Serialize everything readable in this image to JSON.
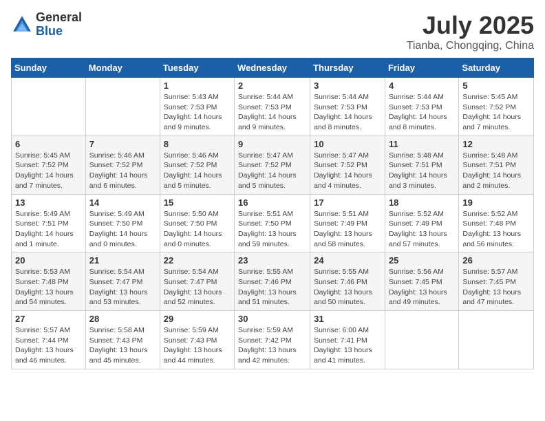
{
  "logo": {
    "general": "General",
    "blue": "Blue"
  },
  "title": {
    "month": "July 2025",
    "location": "Tianba, Chongqing, China"
  },
  "headers": [
    "Sunday",
    "Monday",
    "Tuesday",
    "Wednesday",
    "Thursday",
    "Friday",
    "Saturday"
  ],
  "weeks": [
    [
      {
        "day": "",
        "info": ""
      },
      {
        "day": "",
        "info": ""
      },
      {
        "day": "1",
        "info": "Sunrise: 5:43 AM\nSunset: 7:53 PM\nDaylight: 14 hours and 9 minutes."
      },
      {
        "day": "2",
        "info": "Sunrise: 5:44 AM\nSunset: 7:53 PM\nDaylight: 14 hours and 9 minutes."
      },
      {
        "day": "3",
        "info": "Sunrise: 5:44 AM\nSunset: 7:53 PM\nDaylight: 14 hours and 8 minutes."
      },
      {
        "day": "4",
        "info": "Sunrise: 5:44 AM\nSunset: 7:53 PM\nDaylight: 14 hours and 8 minutes."
      },
      {
        "day": "5",
        "info": "Sunrise: 5:45 AM\nSunset: 7:52 PM\nDaylight: 14 hours and 7 minutes."
      }
    ],
    [
      {
        "day": "6",
        "info": "Sunrise: 5:45 AM\nSunset: 7:52 PM\nDaylight: 14 hours and 7 minutes."
      },
      {
        "day": "7",
        "info": "Sunrise: 5:46 AM\nSunset: 7:52 PM\nDaylight: 14 hours and 6 minutes."
      },
      {
        "day": "8",
        "info": "Sunrise: 5:46 AM\nSunset: 7:52 PM\nDaylight: 14 hours and 5 minutes."
      },
      {
        "day": "9",
        "info": "Sunrise: 5:47 AM\nSunset: 7:52 PM\nDaylight: 14 hours and 5 minutes."
      },
      {
        "day": "10",
        "info": "Sunrise: 5:47 AM\nSunset: 7:52 PM\nDaylight: 14 hours and 4 minutes."
      },
      {
        "day": "11",
        "info": "Sunrise: 5:48 AM\nSunset: 7:51 PM\nDaylight: 14 hours and 3 minutes."
      },
      {
        "day": "12",
        "info": "Sunrise: 5:48 AM\nSunset: 7:51 PM\nDaylight: 14 hours and 2 minutes."
      }
    ],
    [
      {
        "day": "13",
        "info": "Sunrise: 5:49 AM\nSunset: 7:51 PM\nDaylight: 14 hours and 1 minute."
      },
      {
        "day": "14",
        "info": "Sunrise: 5:49 AM\nSunset: 7:50 PM\nDaylight: 14 hours and 0 minutes."
      },
      {
        "day": "15",
        "info": "Sunrise: 5:50 AM\nSunset: 7:50 PM\nDaylight: 14 hours and 0 minutes."
      },
      {
        "day": "16",
        "info": "Sunrise: 5:51 AM\nSunset: 7:50 PM\nDaylight: 13 hours and 59 minutes."
      },
      {
        "day": "17",
        "info": "Sunrise: 5:51 AM\nSunset: 7:49 PM\nDaylight: 13 hours and 58 minutes."
      },
      {
        "day": "18",
        "info": "Sunrise: 5:52 AM\nSunset: 7:49 PM\nDaylight: 13 hours and 57 minutes."
      },
      {
        "day": "19",
        "info": "Sunrise: 5:52 AM\nSunset: 7:48 PM\nDaylight: 13 hours and 56 minutes."
      }
    ],
    [
      {
        "day": "20",
        "info": "Sunrise: 5:53 AM\nSunset: 7:48 PM\nDaylight: 13 hours and 54 minutes."
      },
      {
        "day": "21",
        "info": "Sunrise: 5:54 AM\nSunset: 7:47 PM\nDaylight: 13 hours and 53 minutes."
      },
      {
        "day": "22",
        "info": "Sunrise: 5:54 AM\nSunset: 7:47 PM\nDaylight: 13 hours and 52 minutes."
      },
      {
        "day": "23",
        "info": "Sunrise: 5:55 AM\nSunset: 7:46 PM\nDaylight: 13 hours and 51 minutes."
      },
      {
        "day": "24",
        "info": "Sunrise: 5:55 AM\nSunset: 7:46 PM\nDaylight: 13 hours and 50 minutes."
      },
      {
        "day": "25",
        "info": "Sunrise: 5:56 AM\nSunset: 7:45 PM\nDaylight: 13 hours and 49 minutes."
      },
      {
        "day": "26",
        "info": "Sunrise: 5:57 AM\nSunset: 7:45 PM\nDaylight: 13 hours and 47 minutes."
      }
    ],
    [
      {
        "day": "27",
        "info": "Sunrise: 5:57 AM\nSunset: 7:44 PM\nDaylight: 13 hours and 46 minutes."
      },
      {
        "day": "28",
        "info": "Sunrise: 5:58 AM\nSunset: 7:43 PM\nDaylight: 13 hours and 45 minutes."
      },
      {
        "day": "29",
        "info": "Sunrise: 5:59 AM\nSunset: 7:43 PM\nDaylight: 13 hours and 44 minutes."
      },
      {
        "day": "30",
        "info": "Sunrise: 5:59 AM\nSunset: 7:42 PM\nDaylight: 13 hours and 42 minutes."
      },
      {
        "day": "31",
        "info": "Sunrise: 6:00 AM\nSunset: 7:41 PM\nDaylight: 13 hours and 41 minutes."
      },
      {
        "day": "",
        "info": ""
      },
      {
        "day": "",
        "info": ""
      }
    ]
  ]
}
